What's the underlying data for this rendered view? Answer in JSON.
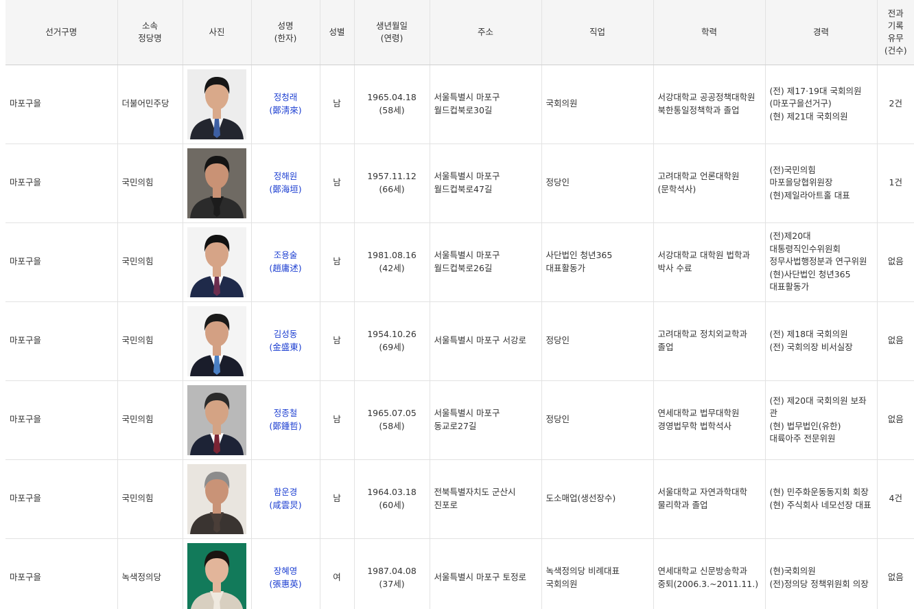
{
  "headers": {
    "district": "선거구명",
    "party": "소속\n정당명",
    "photo": "사진",
    "name": "성명\n(한자)",
    "gender": "성별",
    "birth": "생년월일\n(연령)",
    "address": "주소",
    "job": "직업",
    "education": "학력",
    "career": "경력",
    "record": "전과\n기록\n유무\n(건수)"
  },
  "rows": [
    {
      "district": "마포구을",
      "party": "더불어민주당",
      "name": "정청래",
      "hanja": "(鄭淸來)",
      "gender": "남",
      "birth": "1965.04.18",
      "age": "(58세)",
      "address": "서울특별시 마포구\n월드컵북로30길",
      "job": "국회의원",
      "education": "서강대학교 공공정책대학원\n북한통일정책학과 졸업",
      "career": "(전) 제17·19대 국회의원\n(마포구을선거구)\n(현) 제21대 국회의원",
      "record": "2건",
      "photo": {
        "bg": "#ededed",
        "suit": "#23262f",
        "shirt": "#f2f2f2",
        "tie": "#3d5fa3",
        "hair": "#161616",
        "skin": "#d9a98a"
      }
    },
    {
      "district": "마포구을",
      "party": "국민의힘",
      "name": "정해원",
      "hanja": "(鄭海垣)",
      "gender": "남",
      "birth": "1957.11.12",
      "age": "(66세)",
      "address": "서울특별시 마포구\n월드컵북로47길",
      "job": "정당인",
      "education": "고려대학교 언론대학원\n(문학석사)",
      "career": "(전)국민의힘\n마포을당협위원장\n(현)제일라아트홀 대표",
      "record": "1건",
      "photo": {
        "bg": "#6f6a63",
        "suit": "#2b2b2b",
        "shirt": "#1c1c1c",
        "tie": "#1c1c1c",
        "hair": "#141414",
        "skin": "#c99275"
      }
    },
    {
      "district": "마포구을",
      "party": "국민의힘",
      "name": "조용술",
      "hanja": "(趙庸述)",
      "gender": "남",
      "birth": "1981.08.16",
      "age": "(42세)",
      "address": "서울특별시 마포구\n월드컵북로26길",
      "job": "사단법인 청년365\n대표활동가",
      "education": "서강대학교 대학원 법학과\n박사 수료",
      "career": "(전)제20대\n대통령직인수위원회\n정무사법행정분과 연구위원\n(현)사단법인 청년365\n대표활동가",
      "record": "없음",
      "photo": {
        "bg": "#f3f3f3",
        "suit": "#1f2a4a",
        "shirt": "#ffffff",
        "tie": "#6b2d4e",
        "hair": "#111111",
        "skin": "#d6a487"
      }
    },
    {
      "district": "마포구을",
      "party": "국민의힘",
      "name": "김성동",
      "hanja": "(金盛東)",
      "gender": "남",
      "birth": "1954.10.26",
      "age": "(69세)",
      "address": "서울특별시 마포구 서강로",
      "job": "정당인",
      "education": "고려대학교 정치외교학과\n졸업",
      "career": "(전) 제18대 국회의원\n(전) 국회의장 비서실장",
      "record": "없음",
      "photo": {
        "bg": "#f4f4f4",
        "suit": "#1a1d2b",
        "shirt": "#ffffff",
        "tie": "#4a7fc4",
        "hair": "#1a1a1a",
        "skin": "#d3a083"
      }
    },
    {
      "district": "마포구을",
      "party": "국민의힘",
      "name": "정종철",
      "hanja": "(鄭鍾哲)",
      "gender": "남",
      "birth": "1965.07.05",
      "age": "(58세)",
      "address": "서울특별시 마포구\n동교로27길",
      "job": "정당인",
      "education": "연세대학교 법무대학원\n경영법무학 법학석사",
      "career": "(전) 제20대 국회의원 보좌관\n(현) 법무법인(유한)\n대륙아주 전문위원",
      "record": "없음",
      "photo": {
        "bg": "#b9b9b9",
        "suit": "#1d2336",
        "shirt": "#ffffff",
        "tie": "#7a2434",
        "hair": "#2a2a2a",
        "skin": "#d4a384"
      }
    },
    {
      "district": "마포구을",
      "party": "국민의힘",
      "name": "함운경",
      "hanja": "(咸雲炅)",
      "gender": "남",
      "birth": "1964.03.18",
      "age": "(60세)",
      "address": "전북특별자치도 군산시\n진포로",
      "job": "도소매업(생선장수)",
      "education": "서울대학교 자연과학대학\n물리학과 졸업",
      "career": "(현) 민주화운동동지회 회장\n(현) 주식회사 네모선장 대표",
      "record": "4건",
      "photo": {
        "bg": "#e9e5df",
        "suit": "#3a3431",
        "shirt": "#4a3e38",
        "tie": "#4a3e38",
        "hair": "#8c8c8c",
        "skin": "#c99377"
      }
    },
    {
      "district": "마포구을",
      "party": "녹색정의당",
      "name": "장혜영",
      "hanja": "(張惠英)",
      "gender": "여",
      "birth": "1987.04.08",
      "age": "(37세)",
      "address": "서울특별시 마포구 토정로",
      "job": "녹색정의당 비례대표\n국회의원",
      "education": "연세대학교 신문방송학과\n중퇴(2006.3.~2011.11.)",
      "career": "(현)국회의원\n(전)정의당 정책위원회 의장",
      "record": "없음",
      "photo": {
        "bg": "#127a5a",
        "suit": "#d8cfc0",
        "shirt": "#efe9df",
        "tie": "#efe9df",
        "hair": "#1a1410",
        "skin": "#e2b59a"
      }
    }
  ]
}
